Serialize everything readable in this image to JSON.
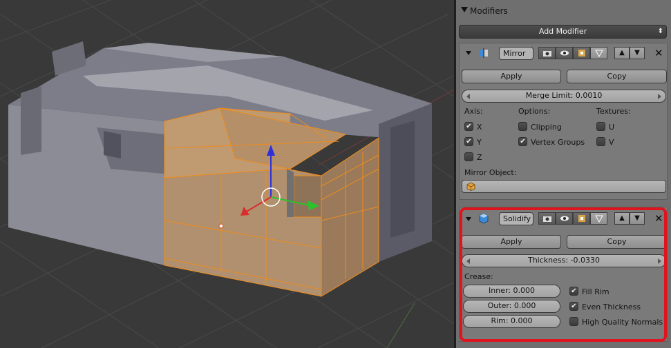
{
  "viewport": {
    "description_name": "3d-viewport"
  },
  "panel": {
    "header_title": "Modifiers",
    "add_modifier_label": "Add Modifier",
    "add_modifier_arrows": "⬍"
  },
  "mirror": {
    "name": "Mirror",
    "apply_label": "Apply",
    "copy_label": "Copy",
    "merge_limit": "Merge Limit: 0.0010",
    "axis_heading": "Axis:",
    "options_heading": "Options:",
    "textures_heading": "Textures:",
    "axis_x": "X",
    "axis_y": "Y",
    "axis_z": "Z",
    "axis_x_checked": true,
    "axis_y_checked": true,
    "axis_z_checked": false,
    "clipping_label": "Clipping",
    "clipping_checked": false,
    "vertex_groups_label": "Vertex Groups",
    "vertex_groups_checked": true,
    "tex_u": "U",
    "tex_v": "V",
    "tex_u_checked": false,
    "tex_v_checked": false,
    "mirror_object_label": "Mirror Object:",
    "mirror_object_value": ""
  },
  "solidify": {
    "name": "Solidify",
    "apply_label": "Apply",
    "copy_label": "Copy",
    "thickness": "Thickness: -0.0330",
    "crease_heading": "Crease:",
    "inner": "Inner: 0.000",
    "outer": "Outer: 0.000",
    "rim": "Rim: 0.000",
    "fill_rim_label": "Fill Rim",
    "fill_rim_checked": true,
    "even_thickness_label": "Even Thickness",
    "even_thickness_checked": true,
    "hq_normals_label": "High Quality Normals",
    "hq_normals_checked": false
  },
  "glyphs": {
    "check": "✔",
    "close": "✕",
    "up": "▲",
    "down": "▼"
  },
  "colors": {
    "highlight": "#e0141e",
    "selection": "#f08c1c",
    "panel_bg": "#6f6f6f",
    "viewport_bg": "#393939"
  }
}
